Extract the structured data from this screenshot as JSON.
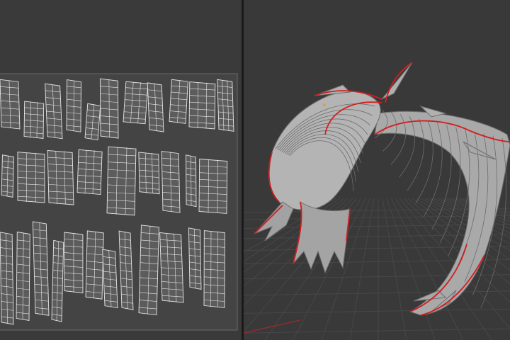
{
  "editors": {
    "left": {
      "type": "uv-editor",
      "content": "uv-islands-grid"
    },
    "right": {
      "type": "3d-viewport",
      "content": "mesh-with-seams"
    }
  },
  "colors": {
    "background": "#3a3a3a",
    "uv_tile": "#444444",
    "uv_island_fill": "#5c5c5c",
    "uv_edge": "#e6e6e6",
    "mesh_fill": "#a8a8a8",
    "seam": "#d21e1e",
    "grid": "#474747",
    "divider": "#1a1a1a"
  },
  "icons": [
    "origin-marker-icon"
  ]
}
